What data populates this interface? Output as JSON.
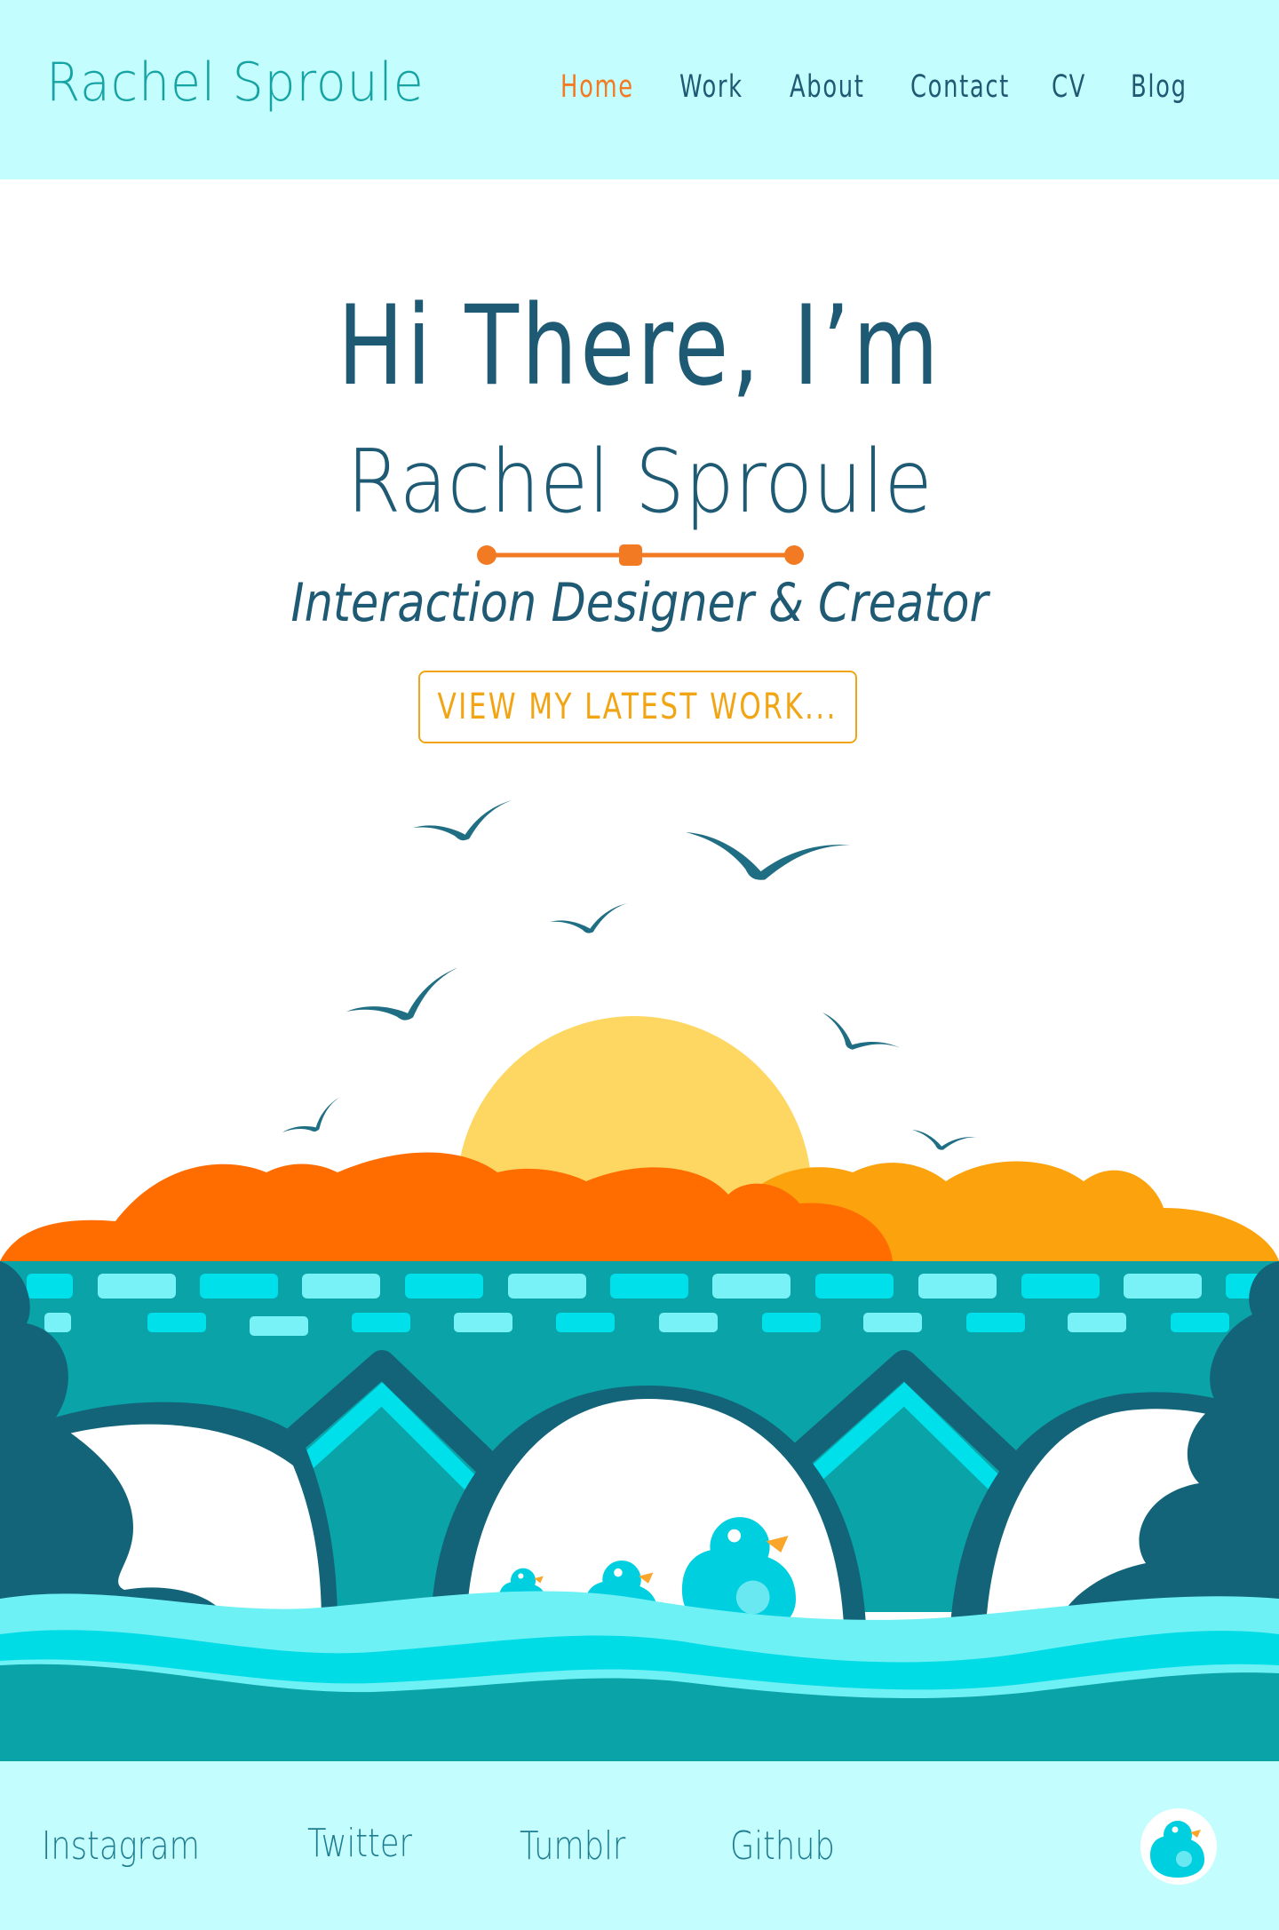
{
  "header": {
    "logo": "Rachel Sproule",
    "nav": [
      {
        "label": "Home",
        "active": true
      },
      {
        "label": "Work",
        "active": false
      },
      {
        "label": "About",
        "active": false
      },
      {
        "label": "Contact",
        "active": false
      },
      {
        "label": "CV",
        "active": false
      },
      {
        "label": "Blog",
        "active": false
      }
    ]
  },
  "hero": {
    "greeting": "Hi There, I’m",
    "name": "Rachel Sproule",
    "subtitle": "Interaction Designer & Creator",
    "cta_label": "VIEW MY LATEST WORK..."
  },
  "footer": {
    "links": [
      "Instagram",
      "Twitter",
      "Tumblr",
      "Github"
    ]
  },
  "colors": {
    "header_bg": "#c4fdfd",
    "text_dark": "#1e5a73",
    "logo_teal": "#16a3a3",
    "accent_orange": "#f27a22",
    "cta_yellow": "#f2a514",
    "sun": "#fdd762",
    "bridge": "#0aa3a8",
    "bridge_dark": "#136479",
    "water_light": "#6df1f5",
    "water_mid": "#00dce6",
    "bird": "#1f6e83"
  },
  "icons": [
    "bird-icon",
    "sun-icon",
    "duck-icon",
    "duck-badge-icon"
  ]
}
